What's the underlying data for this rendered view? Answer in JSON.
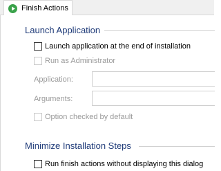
{
  "tab": {
    "label": "Finish Actions",
    "icon": "play-icon",
    "icon_color": "#3aa24a"
  },
  "launch": {
    "title": "Launch Application",
    "launch_checkbox": "Launch application at the end of installation",
    "admin_checkbox": "Run as Administrator",
    "application_label": "Application:",
    "arguments_label": "Arguments:",
    "option_checkbox": "Option checked by default"
  },
  "minimize": {
    "title": "Minimize Installation Steps",
    "run_checkbox": "Run finish actions without displaying this dialog"
  },
  "colors": {
    "group_title": "#1e3a78",
    "disabled_text": "#9a9a9a"
  }
}
